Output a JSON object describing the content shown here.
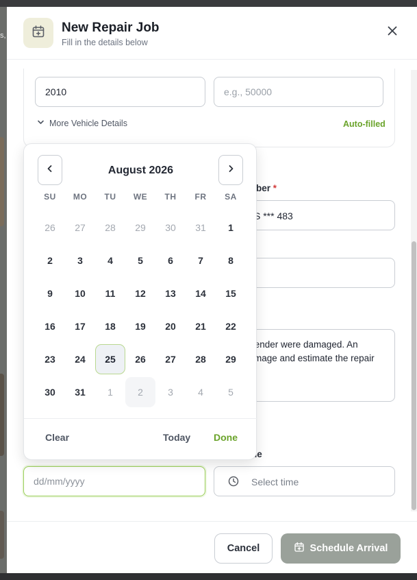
{
  "background": {
    "partial_text": "s,"
  },
  "modal": {
    "title": "New Repair Job",
    "subtitle": "Fill in the details below",
    "icon": "calendar-plus-icon",
    "close_icon": "close-icon"
  },
  "vehicle": {
    "year_value": "2010",
    "mileage_placeholder": "e.g., 50000",
    "more_details_label": "More Vehicle Details",
    "auto_filled_label": "Auto-filled"
  },
  "registration": {
    "label_partial": "mber",
    "required_mark": "*",
    "value_partial": "S *** 483"
  },
  "description": {
    "line1_partial": "fender were damaged. An",
    "line2_partial": "mage and estimate the repair"
  },
  "arrival": {
    "date_label_partial": "",
    "time_label_partial": "ne",
    "date_placeholder": "dd/mm/yyyy",
    "time_placeholder": "Select time"
  },
  "calendar": {
    "month_title": "August 2026",
    "weekdays": [
      "SU",
      "MO",
      "TU",
      "WE",
      "TH",
      "FR",
      "SA"
    ],
    "days": [
      {
        "d": "26",
        "muted": true
      },
      {
        "d": "27",
        "muted": true
      },
      {
        "d": "28",
        "muted": true
      },
      {
        "d": "29",
        "muted": true
      },
      {
        "d": "30",
        "muted": true
      },
      {
        "d": "31",
        "muted": true
      },
      {
        "d": "1"
      },
      {
        "d": "2"
      },
      {
        "d": "3"
      },
      {
        "d": "4"
      },
      {
        "d": "5"
      },
      {
        "d": "6"
      },
      {
        "d": "7"
      },
      {
        "d": "8"
      },
      {
        "d": "9"
      },
      {
        "d": "10"
      },
      {
        "d": "11"
      },
      {
        "d": "12"
      },
      {
        "d": "13"
      },
      {
        "d": "14"
      },
      {
        "d": "15"
      },
      {
        "d": "16"
      },
      {
        "d": "17"
      },
      {
        "d": "18"
      },
      {
        "d": "19"
      },
      {
        "d": "20"
      },
      {
        "d": "21"
      },
      {
        "d": "22"
      },
      {
        "d": "23"
      },
      {
        "d": "24"
      },
      {
        "d": "25",
        "selected": true
      },
      {
        "d": "26"
      },
      {
        "d": "27"
      },
      {
        "d": "28"
      },
      {
        "d": "29"
      },
      {
        "d": "30"
      },
      {
        "d": "31"
      },
      {
        "d": "1",
        "muted": true
      },
      {
        "d": "2",
        "muted": true,
        "hover": true
      },
      {
        "d": "3",
        "muted": true
      },
      {
        "d": "4",
        "muted": true
      },
      {
        "d": "5",
        "muted": true
      }
    ],
    "clear_label": "Clear",
    "today_label": "Today",
    "done_label": "Done"
  },
  "footer": {
    "cancel_label": "Cancel",
    "schedule_label": "Schedule Arrival"
  },
  "colors": {
    "accent_green": "#6aa32a",
    "primary_disabled": "#9aa19a",
    "selected_border": "#b9d890",
    "required_red": "#d23b3b"
  }
}
